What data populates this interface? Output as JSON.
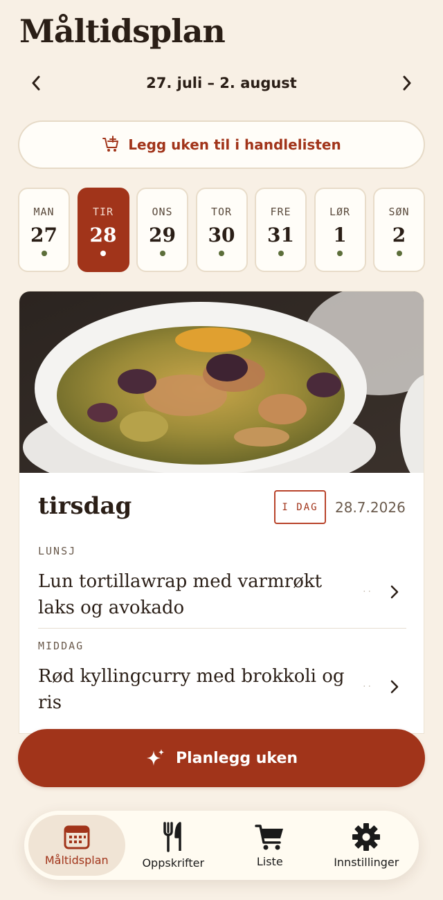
{
  "header": {
    "title": "Måltidsplan"
  },
  "week": {
    "range": "27. juli – 2. august"
  },
  "actions": {
    "add_to_list": "Legg uken til i handlelisten",
    "plan_week": "Planlegg uken"
  },
  "days": [
    {
      "name": "MAN",
      "date": "27"
    },
    {
      "name": "TIR",
      "date": "28",
      "selected": true
    },
    {
      "name": "ONS",
      "date": "29"
    },
    {
      "name": "TOR",
      "date": "30"
    },
    {
      "name": "FRE",
      "date": "31"
    },
    {
      "name": "LØR",
      "date": "1"
    },
    {
      "name": "SØN",
      "date": "2"
    }
  ],
  "selected_day": {
    "heading": "tirsdag",
    "badge": "I DAG",
    "date": "28.7.2026",
    "meals": [
      {
        "type": "LUNSJ",
        "title": "Lun tortillawrap med varmrøkt laks og avokado"
      },
      {
        "type": "MIDDAG",
        "title": "Rød kyllingcurry med brokkoli og ris"
      }
    ]
  },
  "tabs": [
    {
      "label": "Måltidsplan",
      "icon": "calendar-icon",
      "active": true
    },
    {
      "label": "Oppskrifter",
      "icon": "fork-knife-icon"
    },
    {
      "label": "Liste",
      "icon": "cart-icon"
    },
    {
      "label": "Innstillinger",
      "icon": "gear-icon"
    }
  ],
  "colors": {
    "accent": "#a1341a",
    "background": "#f8f0e5",
    "dot": "#5c6e3a"
  }
}
